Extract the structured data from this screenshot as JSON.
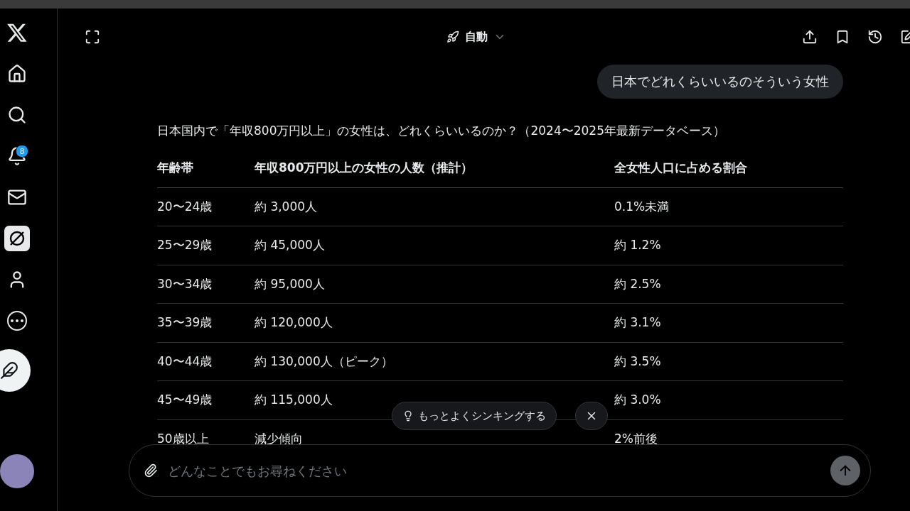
{
  "sidebar": {
    "items": [
      {
        "kind": "logo",
        "selected": false
      },
      {
        "kind": "home",
        "selected": false
      },
      {
        "kind": "search",
        "selected": false
      },
      {
        "kind": "bell",
        "selected": false,
        "badge": "8"
      },
      {
        "kind": "mail",
        "selected": false
      },
      {
        "kind": "grok",
        "selected": true
      },
      {
        "kind": "person",
        "selected": false
      },
      {
        "kind": "more",
        "selected": false
      }
    ]
  },
  "top_bar": {
    "mode": "自動"
  },
  "user_message": "日本でどれくらいいるのそういう女性",
  "answer": {
    "heading": "日本国内で「年収800万円以上」の女性は、どれくらいいるのか？（2024〜2025年最新データベース）",
    "table": {
      "columns": [
        "年齢帯",
        "年収800万円以上の女性の人数（推計）",
        "全女性人口に占める割合"
      ],
      "rows": [
        [
          "20〜24歳",
          "約 3,000人",
          "0.1%未満"
        ],
        [
          "25〜29歳",
          "約 45,000人",
          "約 1.2%"
        ],
        [
          "30〜34歳",
          "約 95,000人",
          "約 2.5%"
        ],
        [
          "35〜39歳",
          "約 120,000人",
          "約 3.1%"
        ],
        [
          "40〜44歳",
          "約 130,000人（ピーク）",
          "約 3.5%"
        ],
        [
          "45〜49歳",
          "約 115,000人",
          "約 3.0%"
        ],
        [
          "50歳以上",
          "減少傾向",
          "2%前後"
        ]
      ]
    }
  },
  "suggestion": "もっとよくシンキングする",
  "composer": {
    "placeholder": "どんなことでもお尋ねください"
  }
}
